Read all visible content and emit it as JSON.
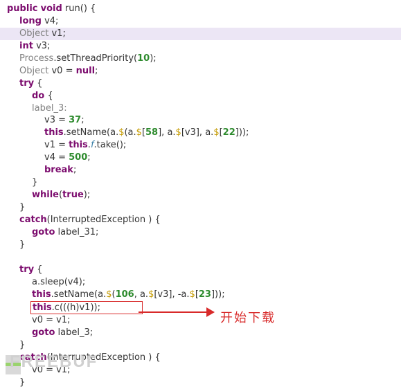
{
  "code": {
    "run_decl_public": "public",
    "run_decl_void": "void",
    "run_decl_name": " run() {",
    "long_kw": "long",
    "v4_decl": " v4;",
    "object_g": "Object",
    "v1_decl": " v1;",
    "int_kw": "int",
    "v3_decl": " v3;",
    "process_g": "Process",
    "stp_dot": ".setThreadPriority(",
    "stp_num": "10",
    "stp_end": ");",
    "obj_v0": " v0 = ",
    "null_kw": "null",
    "semi": ";",
    "try_kw": "try",
    "obrace": " {",
    "do_kw": "do",
    "label3_g": "label_3:",
    "v3_assign_l": "v3 = ",
    "v3_assign_n": "37",
    "this_kw": "this",
    "setname1_pre": ".setName(a.",
    "img_S": "$",
    "setname1_mid1": "(a.",
    "setname1_idx58": "58",
    "setname1_mid2": "], a.",
    "setname1_mid3": "[v3], a.",
    "setname1_idx22": "22",
    "setname1_end": "]));",
    "v1eq": "v1 = ",
    "f_field": "f",
    "take": ".take();",
    "v4eq": "v4 = ",
    "n500": "500",
    "break_kw": "break",
    "cbrace": "}",
    "while_kw": "while",
    "while_arg": "(",
    "true_kw": "true",
    "while_end": ");",
    "catch_kw": "catch",
    "catch_arg": "(InterruptedException ) {",
    "goto_kw": "goto",
    "goto_l31": " label_31;",
    "asleep_pre": "a.sleep(v4);",
    "setname2_pre": ".setName(a.",
    "setname2_idx106": "106",
    "setname2_mid1": ", a.",
    "setname2_mid2": "[v3], -a.",
    "setname2_idx23": "23",
    "setname2_end": "]));",
    "boxed_pre": ".c(((h)v1));",
    "v0v1": "v0 = v1;",
    "goto_l3": " label_3;",
    "catch2_body": "v0 = v1;"
  },
  "annotation": "开始下载",
  "watermark": "FREEBUF"
}
